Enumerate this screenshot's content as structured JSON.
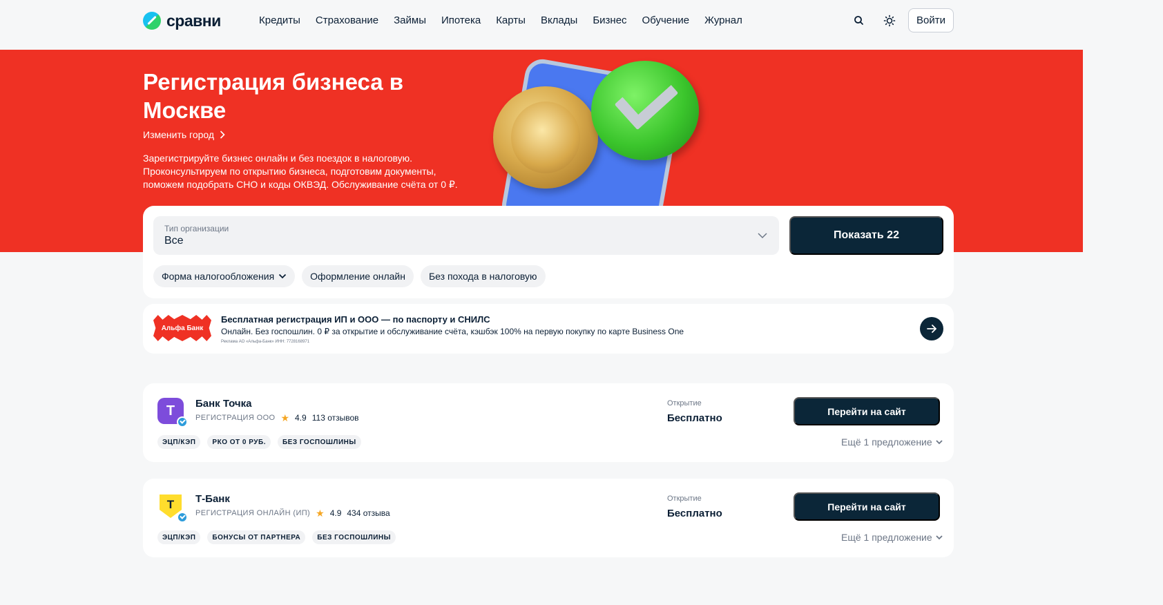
{
  "header": {
    "logo_text": "сравни",
    "nav": [
      "Кредиты",
      "Страхование",
      "Займы",
      "Ипотека",
      "Карты",
      "Вклады",
      "Бизнес",
      "Обучение",
      "Журнал"
    ],
    "login_label": "Войти"
  },
  "hero": {
    "title": "Регистрация бизнеса в Москве",
    "change_city": "Изменить город",
    "description": "Зарегистрируйте бизнес онлайн и без поездок в налоговую. Проконсультируем по открытию бизнеса, подготовим документы, поможем подобрать СНО и коды ОКВЭД. Обслуживание счёта от 0 ₽."
  },
  "filter": {
    "select_label": "Тип организации",
    "select_value": "Все",
    "show_button": "Показать 22",
    "chips": [
      "Форма налогообложения",
      "Оформление онлайн",
      "Без похода в налоговую"
    ]
  },
  "ad": {
    "logo_text": "Альфа Банк",
    "title": "Бесплатная регистрация ИП и ООО — по паспорту и СНИЛС",
    "text": "Онлайн. Без госпошлин. 0 ₽ за открытие и обслуживание счёта, кэшбэк 100% на первую покупку по карте Business One",
    "legal": "Реклама АО «Альфа-Банк» ИНН: 7728168971"
  },
  "offers": [
    {
      "logo_letter": "Т",
      "name": "Банк Точка",
      "type": "Регистрация ООО",
      "rating": "4.9",
      "reviews": "113 отзывов",
      "tags": [
        "ЭЦП/КЭП",
        "РКО от 0 руб.",
        "Без госпошлины"
      ],
      "opening_label": "Открытие",
      "opening_value": "Бесплатно",
      "button": "Перейти на сайт",
      "more": "Ещё 1 предложение"
    },
    {
      "logo_letter": "Т",
      "name": "Т-Банк",
      "type": "Регистрация онлайн (ИП)",
      "rating": "4.9",
      "reviews": "434 отзыва",
      "tags": [
        "ЭЦП/КЭП",
        "Бонусы от партнера",
        "Без госпошлины"
      ],
      "opening_label": "Открытие",
      "opening_value": "Бесплатно",
      "button": "Перейти на сайт",
      "more": "Ещё 1 предложение"
    }
  ],
  "colors": {
    "hero_red": "#ef3124",
    "dark_button": "#0b2638",
    "tochka_purple": "#7d4cdb",
    "tbank_yellow": "#ffdd2d",
    "star": "#f5a623"
  }
}
